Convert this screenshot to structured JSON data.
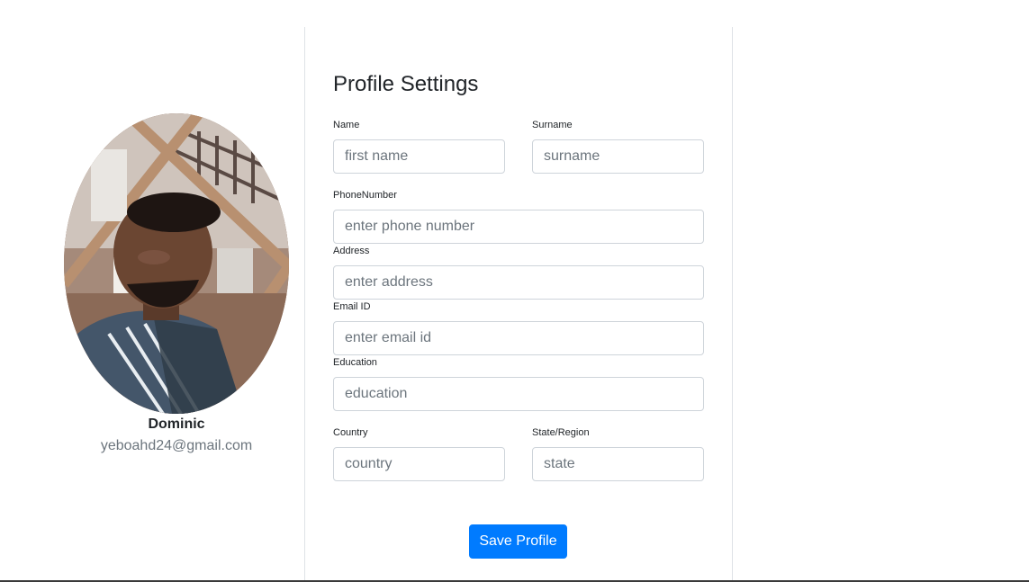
{
  "profile": {
    "name": "Dominic",
    "email": "yeboahd24@gmail.com"
  },
  "form": {
    "title": "Profile Settings",
    "name_label": "Name",
    "name_placeholder": "first name",
    "surname_label": "Surname",
    "surname_placeholder": "surname",
    "phone_label": "PhoneNumber",
    "phone_placeholder": "enter phone number",
    "address_label": "Address",
    "address_placeholder": "enter address",
    "email_label": "Email ID",
    "email_placeholder": "enter email id",
    "education_label": "Education",
    "education_placeholder": "education",
    "country_label": "Country",
    "country_placeholder": "country",
    "state_label": "State/Region",
    "state_placeholder": "state",
    "save_label": "Save Profile"
  },
  "colors": {
    "primary": "#007bff",
    "muted_text": "#6c757d",
    "border": "#ced4da"
  }
}
